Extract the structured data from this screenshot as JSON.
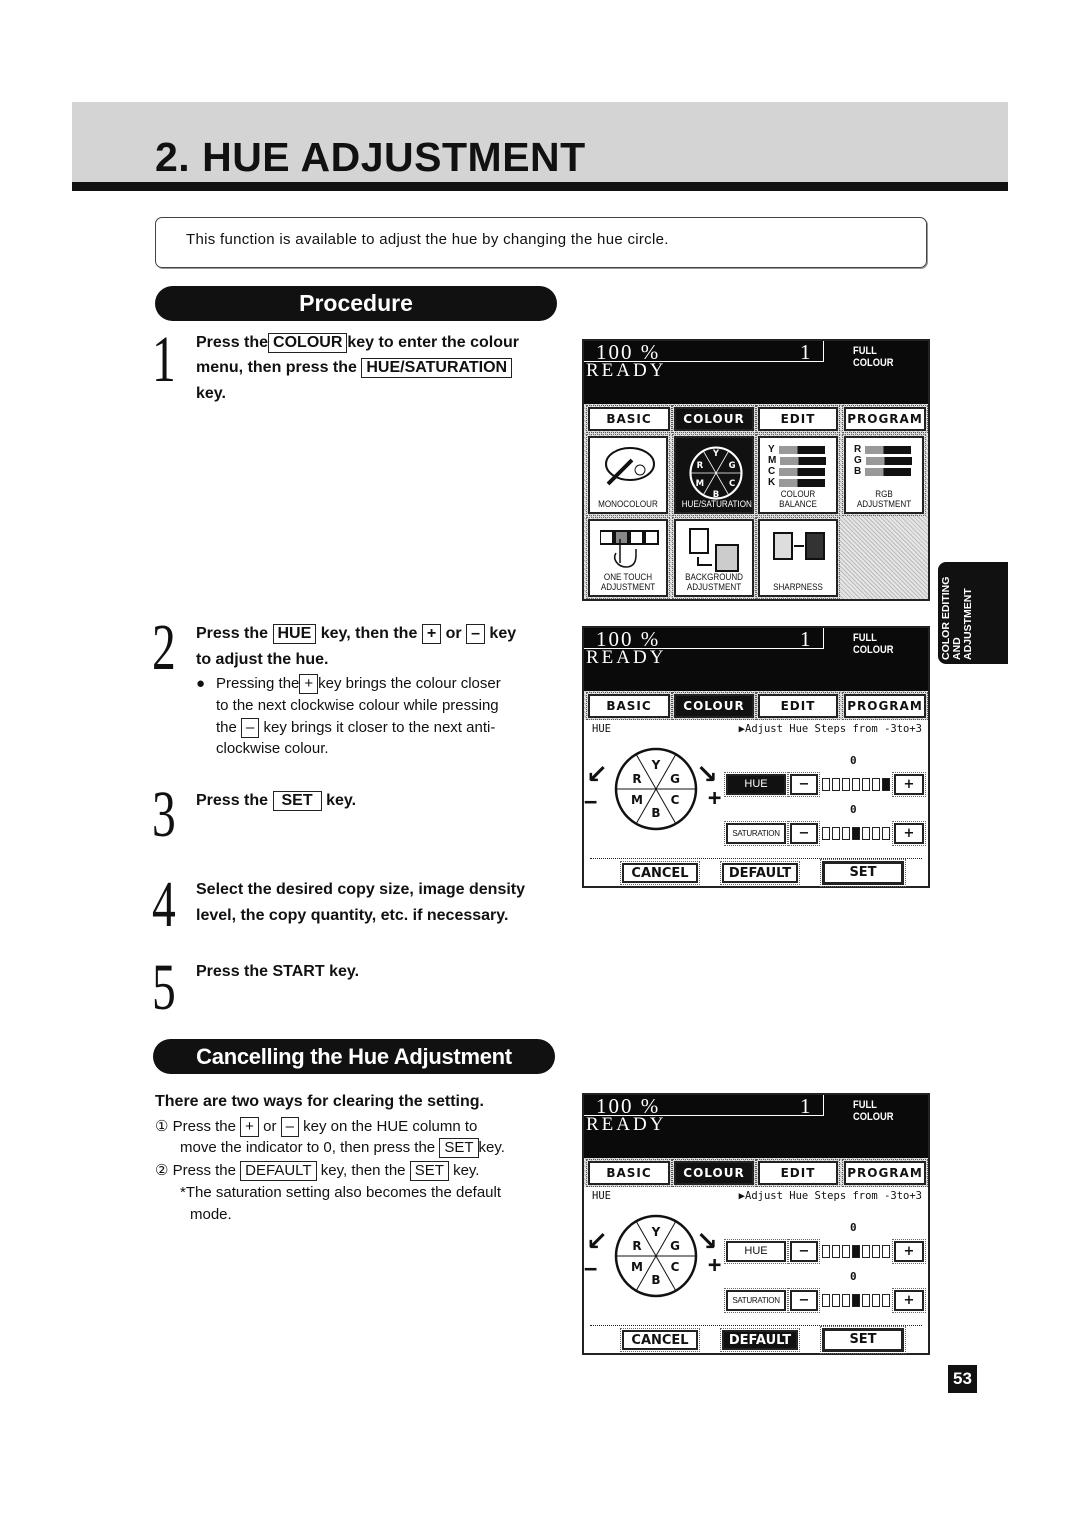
{
  "header": {
    "title": "2. HUE ADJUSTMENT"
  },
  "info": "This function is available to adjust the hue by changing the hue circle.",
  "procedure_label": "Procedure",
  "steps": [
    {
      "number": "1",
      "l1a": "Press the",
      "k1": "COLOUR",
      "l1b": "key to enter the colour",
      "l2a": "menu, then press the",
      "k2": "HUE/SATURATION",
      "l3": "key."
    },
    {
      "number": "2",
      "a": "Press the",
      "k1": "HUE",
      "b": "key, then the",
      "k2": "+",
      "c": "or",
      "k3": "–",
      "d": "key",
      "l2": "to adjust the hue.",
      "bullet": {
        "a": "Pressing the",
        "k1": "+",
        "b": "key brings the colour closer",
        "l2": "to the next clockwise colour while pressing",
        "c": "the",
        "k2": "–",
        "d": "key brings it closer to the next anti-",
        "l4": "clockwise colour."
      }
    },
    {
      "number": "3",
      "a": "Press the",
      "k": "SET",
      "b": "key."
    },
    {
      "number": "4",
      "l1": "Select the desired copy size, image density",
      "l2": "level, the copy quantity, etc. if necessary."
    },
    {
      "number": "5",
      "l1": "Press the START key."
    }
  ],
  "cancel": {
    "title": "Cancelling the Hue Adjustment",
    "intro": "There are two ways for clearing the setting.",
    "m1": {
      "mark": "①",
      "a": "Press the",
      "k1": "+",
      "b": "or",
      "k2": "–",
      "c": "key on the HUE column to",
      "d": "move the indicator to 0, then press the",
      "k3": "SET",
      "e": "key."
    },
    "m2": {
      "mark": "②",
      "a": "Press the",
      "k1": "DEFAULT",
      "b": "key, then the",
      "k2": "SET",
      "c": "key."
    },
    "note1": "*The saturation setting also becomes the default",
    "note2": "mode."
  },
  "side_tab": "COLOR EDITING AND ADJUSTMENT",
  "page_number": "53",
  "panel_common": {
    "zoom": "100 %",
    "count": "1",
    "mode": "FULL COLOUR",
    "status": "READY",
    "tabs": [
      "BASIC",
      "COLOUR",
      "EDIT",
      "PROGRAM"
    ],
    "selected_tab": "COLOUR"
  },
  "panels": [
    {
      "type": "menu",
      "tiles": [
        {
          "label": "MONOCOLOUR",
          "icon": "palette-icon",
          "selected": false
        },
        {
          "label": "HUE/SATURATION",
          "icon": "hue-circle-icon",
          "selected": true
        },
        {
          "label": "COLOUR BALANCE",
          "icon": "ymck-bars-icon",
          "selected": false,
          "bars": [
            "Y",
            "M",
            "C",
            "K"
          ]
        },
        {
          "label": "RGB ADJUSTMENT",
          "icon": "rgb-bars-icon",
          "selected": false,
          "bars": [
            "R",
            "G",
            "B"
          ]
        },
        {
          "label": "ONE TOUCH ADJUSTMENT",
          "icon": "touch-hand-icon",
          "selected": false
        },
        {
          "label": "BACKGROUND ADJUSTMENT",
          "icon": "background-icon",
          "selected": false
        },
        {
          "label": "SHARPNESS",
          "icon": "sharpness-icon",
          "selected": false
        }
      ]
    },
    {
      "type": "hue",
      "hue_value": 3,
      "saturation_value": 0,
      "highlight": "HUE"
    },
    {
      "type": "hue",
      "hue_value": 0,
      "saturation_value": 0,
      "highlight": "DEFAULT"
    }
  ],
  "hue_screen": {
    "label": "HUE",
    "instruction": "▶Adjust Hue Steps from -3to+3",
    "zero": "0",
    "hue_btn": "HUE",
    "sat_btn": "SATURATION",
    "minus": "−",
    "plus": "+",
    "wheel": [
      "Y",
      "G",
      "C",
      "B",
      "M",
      "R"
    ],
    "cancel": "CANCEL",
    "default": "DEFAULT",
    "set": "SET",
    "range": [
      -3,
      3
    ]
  }
}
